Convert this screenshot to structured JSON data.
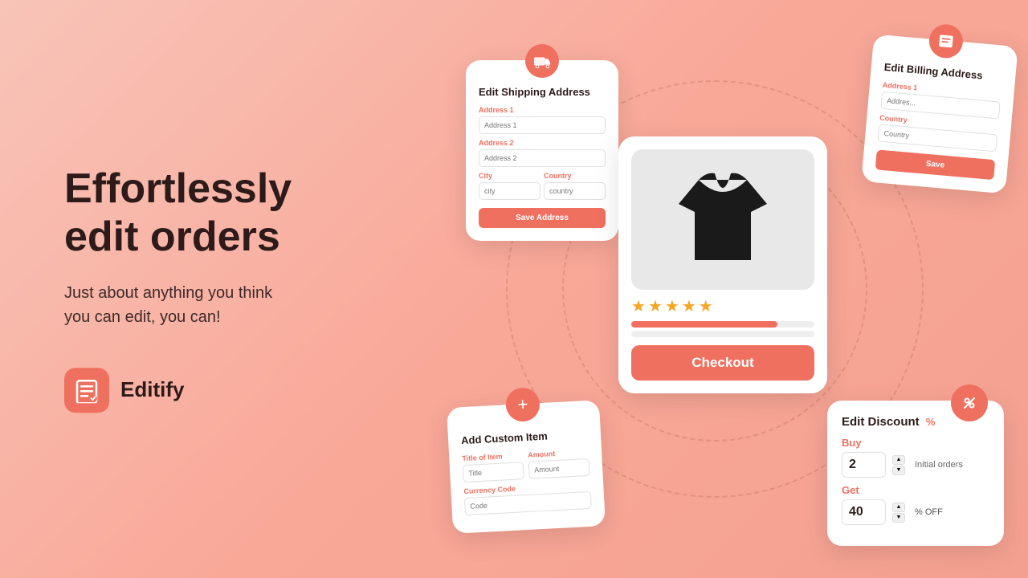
{
  "left": {
    "headline_line1": "Effortlessly",
    "headline_line2": "edit orders",
    "subtext_line1": "Just about anything you think",
    "subtext_line2": "you can edit, you can!",
    "brand_name": "Editify"
  },
  "shipping_card": {
    "title": "Edit Shipping Address",
    "address1_label": "Address 1",
    "address1_placeholder": "Address 1",
    "address2_label": "Address 2",
    "address2_placeholder": "Address 2",
    "city_label": "City",
    "city_placeholder": "city",
    "country_label": "Country",
    "country_placeholder": "country",
    "save_btn": "Save Address"
  },
  "billing_card": {
    "title": "Edit Billing Address",
    "address1_label": "Address 1",
    "address1_placeholder": "Addres...",
    "country_label": "Country",
    "country_placeholder": "Country"
  },
  "product_card": {
    "stars": 5,
    "checkout_btn": "Checkout"
  },
  "custom_item_card": {
    "title": "Add Custom Item",
    "title_label": "Title of Item",
    "title_placeholder": "Title",
    "amount_label": "Amount",
    "amount_placeholder": "Amount",
    "currency_label": "Currency Code",
    "currency_placeholder": "Code"
  },
  "discount_card": {
    "title": "Edit Discount",
    "buy_label": "Buy",
    "buy_value": "2",
    "buy_note": "Initial orders",
    "get_label": "Get",
    "get_value": "40",
    "get_note": "% OFF"
  }
}
